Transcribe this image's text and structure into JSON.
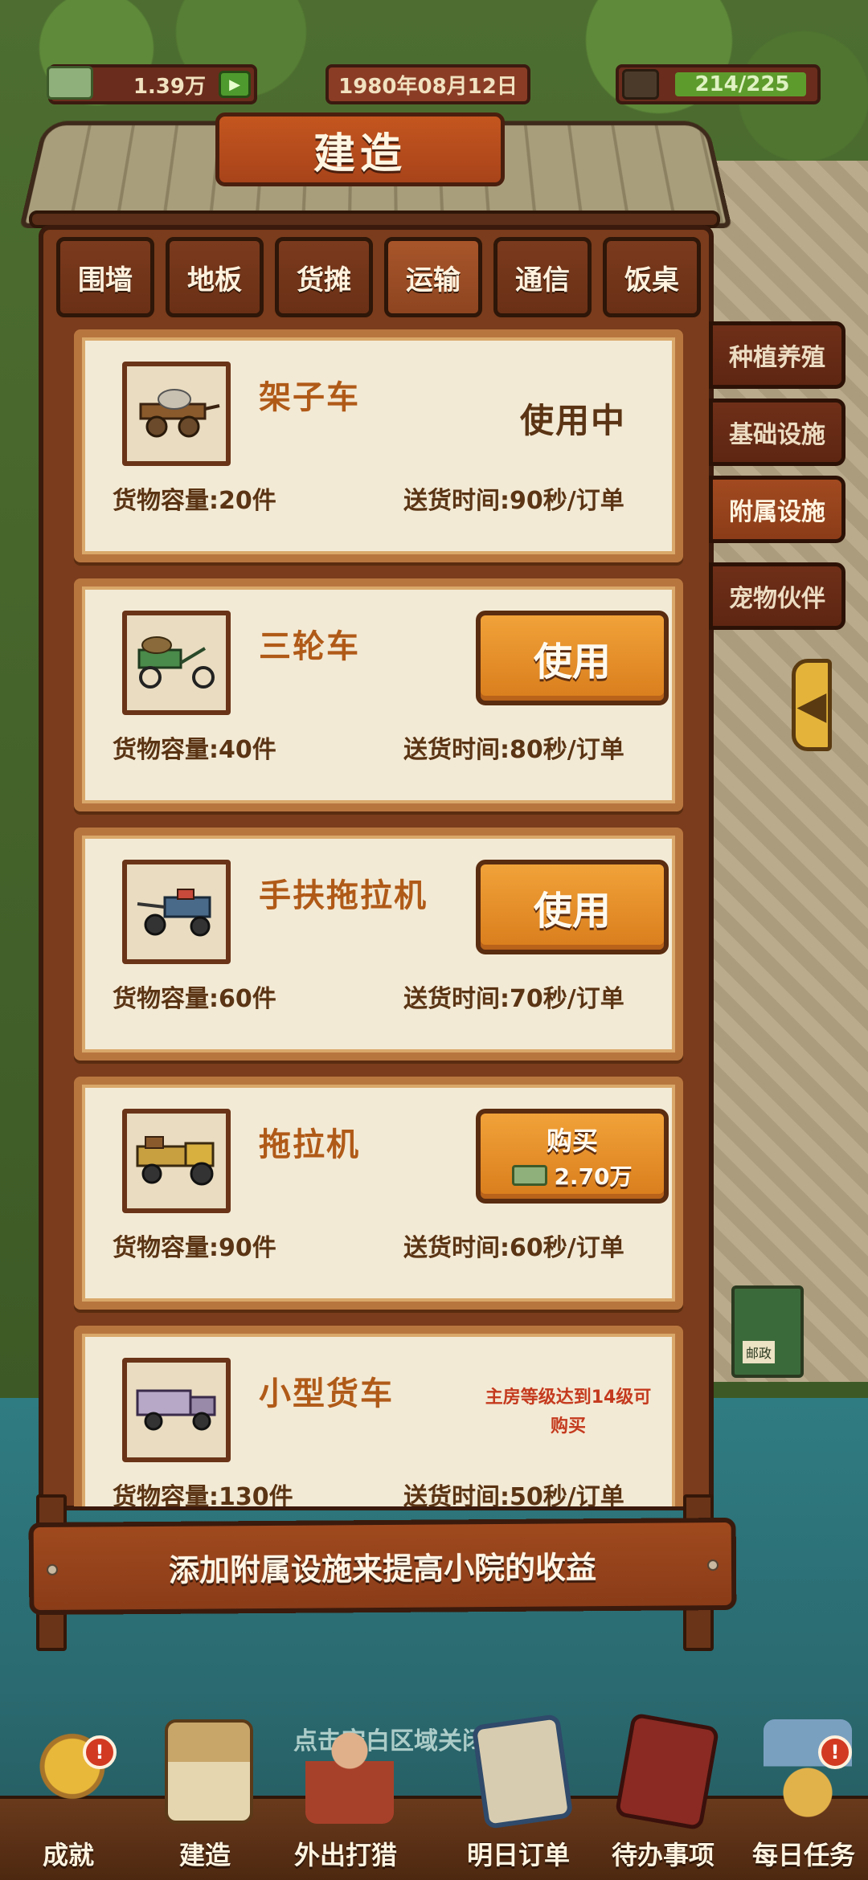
{
  "status_bar": {
    "money": "1.39万",
    "date": "1980年08月12日",
    "energy": "214/225"
  },
  "title": "建造",
  "tabs": [
    {
      "label": "围墙",
      "active": false
    },
    {
      "label": "地板",
      "active": false
    },
    {
      "label": "货摊",
      "active": false
    },
    {
      "label": "运输",
      "active": true
    },
    {
      "label": "通信",
      "active": false
    },
    {
      "label": "饭桌",
      "active": false
    }
  ],
  "side_tabs": [
    {
      "label": "种植养殖",
      "active": false
    },
    {
      "label": "基础设施",
      "active": false
    },
    {
      "label": "附属设施",
      "active": true
    },
    {
      "label": "宠物伙伴",
      "active": false
    }
  ],
  "items": [
    {
      "name": "架子车",
      "icon": "handcart-icon",
      "capacity": "货物容量:20件",
      "delivery": "送货时间:90秒/订单",
      "state": "in_use",
      "status_text": "使用中"
    },
    {
      "name": "三轮车",
      "icon": "tricycle-icon",
      "capacity": "货物容量:40件",
      "delivery": "送货时间:80秒/订单",
      "state": "use",
      "button_label": "使用"
    },
    {
      "name": "手扶拖拉机",
      "icon": "walking-tractor-icon",
      "capacity": "货物容量:60件",
      "delivery": "送货时间:70秒/订单",
      "state": "use",
      "button_label": "使用"
    },
    {
      "name": "拖拉机",
      "icon": "tractor-icon",
      "capacity": "货物容量:90件",
      "delivery": "送货时间:60秒/订单",
      "state": "buy",
      "button_label": "购买",
      "price": "2.70万"
    },
    {
      "name": "小型货车",
      "icon": "small-truck-icon",
      "capacity": "货物容量:130件",
      "delivery": "送货时间:50秒/订单",
      "state": "locked",
      "lock_text": "主房等级达到14级可购买"
    }
  ],
  "tip": "添加附属设施来提高小院的收益",
  "close_hint": "点击空白区域关闭",
  "mailbox_label": "邮政",
  "bottom_nav": [
    {
      "label": "成就",
      "icon": "trophy-icon",
      "badge": "!"
    },
    {
      "label": "建造",
      "icon": "house-icon"
    },
    {
      "label": "外出打猎",
      "icon": "hunter-icon"
    },
    {
      "label": "明日订单",
      "icon": "clipboard-icon"
    },
    {
      "label": "待办事项",
      "icon": "notebook-icon"
    },
    {
      "label": "每日任务",
      "icon": "daily-task-icon",
      "badge": "!"
    }
  ],
  "colors": {
    "wood_dark": "#3a1a0c",
    "wood": "#7a3c1c",
    "card_bg": "#f3ead5",
    "title_text": "#b05a18",
    "button": "#e88f2a",
    "lock_text": "#c43a1e"
  }
}
